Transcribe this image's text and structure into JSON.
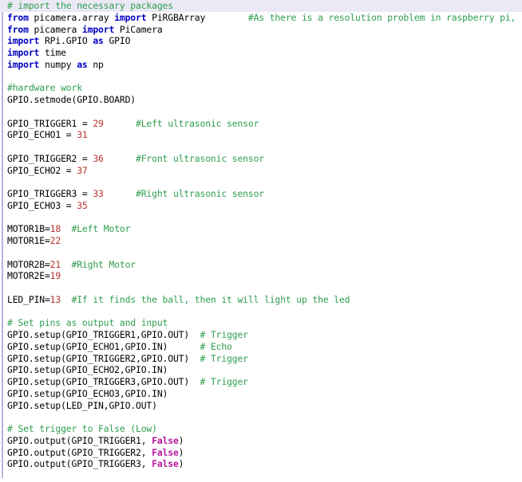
{
  "document": {
    "kind": "source-code-listing",
    "language": "Python",
    "colors": {
      "background": "#ffffff",
      "highlight_band": "#ece9f6",
      "gutter_rule": "#b9b2dd",
      "keyword": "#0000c0",
      "comment": "#2f9e4f",
      "number": "#b5322e",
      "constant": "#b5179e",
      "plain_text": "#000000"
    }
  },
  "code": {
    "lines": [
      {
        "highlight": true,
        "tokens": [
          {
            "t": "comment",
            "s": "# import the necessary packages"
          }
        ]
      },
      {
        "highlight": false,
        "tokens": [
          {
            "t": "kw",
            "s": "from"
          },
          {
            "t": "plain",
            "s": " picamera.array "
          },
          {
            "t": "kw",
            "s": "import"
          },
          {
            "t": "plain",
            "s": " PiRGBArray        "
          },
          {
            "t": "comment",
            "s": "#As there is a resolution problem in raspberry pi,"
          }
        ]
      },
      {
        "highlight": false,
        "tokens": [
          {
            "t": "kw",
            "s": "from"
          },
          {
            "t": "plain",
            "s": " picamera "
          },
          {
            "t": "kw",
            "s": "import"
          },
          {
            "t": "plain",
            "s": " PiCamera"
          }
        ]
      },
      {
        "highlight": false,
        "tokens": [
          {
            "t": "kw",
            "s": "import"
          },
          {
            "t": "plain",
            "s": " RPi.GPIO "
          },
          {
            "t": "kw",
            "s": "as"
          },
          {
            "t": "plain",
            "s": " GPIO"
          }
        ]
      },
      {
        "highlight": false,
        "tokens": [
          {
            "t": "kw",
            "s": "import"
          },
          {
            "t": "plain",
            "s": " time"
          }
        ]
      },
      {
        "highlight": false,
        "tokens": [
          {
            "t": "kw",
            "s": "import"
          },
          {
            "t": "plain",
            "s": " numpy "
          },
          {
            "t": "kw",
            "s": "as"
          },
          {
            "t": "plain",
            "s": " np"
          }
        ]
      },
      {
        "highlight": false,
        "tokens": []
      },
      {
        "highlight": false,
        "tokens": [
          {
            "t": "comment",
            "s": "#hardware work"
          }
        ]
      },
      {
        "highlight": false,
        "tokens": [
          {
            "t": "plain",
            "s": "GPIO.setmode(GPIO.BOARD)"
          }
        ]
      },
      {
        "highlight": false,
        "tokens": []
      },
      {
        "highlight": false,
        "tokens": [
          {
            "t": "plain",
            "s": "GPIO_TRIGGER1 = "
          },
          {
            "t": "num",
            "s": "29"
          },
          {
            "t": "plain",
            "s": "      "
          },
          {
            "t": "comment",
            "s": "#Left ultrasonic sensor"
          }
        ]
      },
      {
        "highlight": false,
        "tokens": [
          {
            "t": "plain",
            "s": "GPIO_ECHO1 = "
          },
          {
            "t": "num",
            "s": "31"
          }
        ]
      },
      {
        "highlight": false,
        "tokens": []
      },
      {
        "highlight": false,
        "tokens": [
          {
            "t": "plain",
            "s": "GPIO_TRIGGER2 = "
          },
          {
            "t": "num",
            "s": "36"
          },
          {
            "t": "plain",
            "s": "      "
          },
          {
            "t": "comment",
            "s": "#Front ultrasonic sensor"
          }
        ]
      },
      {
        "highlight": false,
        "tokens": [
          {
            "t": "plain",
            "s": "GPIO_ECHO2 = "
          },
          {
            "t": "num",
            "s": "37"
          }
        ]
      },
      {
        "highlight": false,
        "tokens": []
      },
      {
        "highlight": false,
        "tokens": [
          {
            "t": "plain",
            "s": "GPIO_TRIGGER3 = "
          },
          {
            "t": "num",
            "s": "33"
          },
          {
            "t": "plain",
            "s": "      "
          },
          {
            "t": "comment",
            "s": "#Right ultrasonic sensor"
          }
        ]
      },
      {
        "highlight": false,
        "tokens": [
          {
            "t": "plain",
            "s": "GPIO_ECHO3 = "
          },
          {
            "t": "num",
            "s": "35"
          }
        ]
      },
      {
        "highlight": false,
        "tokens": []
      },
      {
        "highlight": false,
        "tokens": [
          {
            "t": "plain",
            "s": "MOTOR1B="
          },
          {
            "t": "num",
            "s": "18"
          },
          {
            "t": "plain",
            "s": "  "
          },
          {
            "t": "comment",
            "s": "#Left Motor"
          }
        ]
      },
      {
        "highlight": false,
        "tokens": [
          {
            "t": "plain",
            "s": "MOTOR1E="
          },
          {
            "t": "num",
            "s": "22"
          }
        ]
      },
      {
        "highlight": false,
        "tokens": []
      },
      {
        "highlight": false,
        "tokens": [
          {
            "t": "plain",
            "s": "MOTOR2B="
          },
          {
            "t": "num",
            "s": "21"
          },
          {
            "t": "plain",
            "s": "  "
          },
          {
            "t": "comment",
            "s": "#Right Motor"
          }
        ]
      },
      {
        "highlight": false,
        "tokens": [
          {
            "t": "plain",
            "s": "MOTOR2E="
          },
          {
            "t": "num",
            "s": "19"
          }
        ]
      },
      {
        "highlight": false,
        "tokens": []
      },
      {
        "highlight": false,
        "tokens": [
          {
            "t": "plain",
            "s": "LED_PIN="
          },
          {
            "t": "num",
            "s": "13"
          },
          {
            "t": "plain",
            "s": "  "
          },
          {
            "t": "comment",
            "s": "#If it finds the ball, then it will light up the led"
          }
        ]
      },
      {
        "highlight": false,
        "tokens": []
      },
      {
        "highlight": false,
        "tokens": [
          {
            "t": "comment",
            "s": "# Set pins as output and input"
          }
        ]
      },
      {
        "highlight": false,
        "tokens": [
          {
            "t": "plain",
            "s": "GPIO.setup(GPIO_TRIGGER1,GPIO.OUT)  "
          },
          {
            "t": "comment",
            "s": "# Trigger"
          }
        ]
      },
      {
        "highlight": false,
        "tokens": [
          {
            "t": "plain",
            "s": "GPIO.setup(GPIO_ECHO1,GPIO.IN)      "
          },
          {
            "t": "comment",
            "s": "# Echo"
          }
        ]
      },
      {
        "highlight": false,
        "tokens": [
          {
            "t": "plain",
            "s": "GPIO.setup(GPIO_TRIGGER2,GPIO.OUT)  "
          },
          {
            "t": "comment",
            "s": "# Trigger"
          }
        ]
      },
      {
        "highlight": false,
        "tokens": [
          {
            "t": "plain",
            "s": "GPIO.setup(GPIO_ECHO2,GPIO.IN)"
          }
        ]
      },
      {
        "highlight": false,
        "tokens": [
          {
            "t": "plain",
            "s": "GPIO.setup(GPIO_TRIGGER3,GPIO.OUT)  "
          },
          {
            "t": "comment",
            "s": "# Trigger"
          }
        ]
      },
      {
        "highlight": false,
        "tokens": [
          {
            "t": "plain",
            "s": "GPIO.setup(GPIO_ECHO3,GPIO.IN)"
          }
        ]
      },
      {
        "highlight": false,
        "tokens": [
          {
            "t": "plain",
            "s": "GPIO.setup(LED_PIN,GPIO.OUT)"
          }
        ]
      },
      {
        "highlight": false,
        "tokens": []
      },
      {
        "highlight": false,
        "tokens": [
          {
            "t": "comment",
            "s": "# Set trigger to False (Low)"
          }
        ]
      },
      {
        "highlight": false,
        "tokens": [
          {
            "t": "plain",
            "s": "GPIO.output(GPIO_TRIGGER1, "
          },
          {
            "t": "const",
            "s": "False"
          },
          {
            "t": "plain",
            "s": ")"
          }
        ]
      },
      {
        "highlight": false,
        "tokens": [
          {
            "t": "plain",
            "s": "GPIO.output(GPIO_TRIGGER2, "
          },
          {
            "t": "const",
            "s": "False"
          },
          {
            "t": "plain",
            "s": ")"
          }
        ]
      },
      {
        "highlight": false,
        "tokens": [
          {
            "t": "plain",
            "s": "GPIO.output(GPIO_TRIGGER3, "
          },
          {
            "t": "const",
            "s": "False"
          },
          {
            "t": "plain",
            "s": ")"
          }
        ]
      },
      {
        "highlight": false,
        "tokens": []
      }
    ]
  }
}
